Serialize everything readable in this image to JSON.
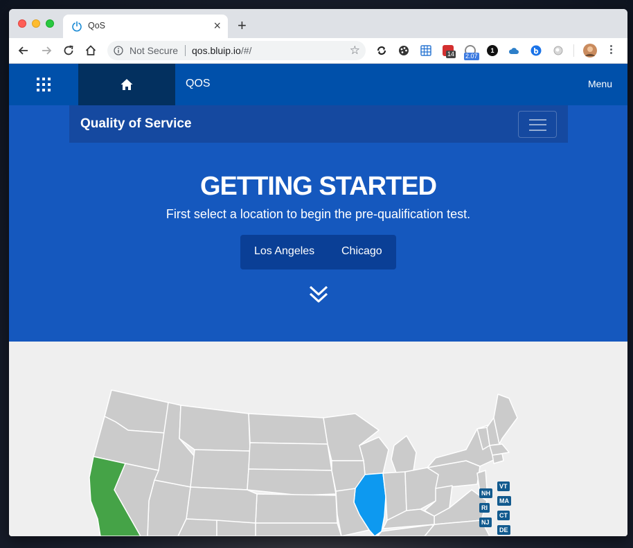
{
  "browser": {
    "tab_title": "QoS",
    "address_security": "Not Secure",
    "address_host": "qos.bluip.io",
    "address_path": "/#/",
    "ext_badges": [
      "14",
      "2.07"
    ],
    "ext_count_label": "1"
  },
  "topnav": {
    "brand": "QOS",
    "menu_label": "Menu"
  },
  "subnav": {
    "title": "Quality of Service"
  },
  "hero": {
    "title": "GETTING STARTED",
    "subtitle": "First select a location to begin the pre-qualification test.",
    "locations": [
      "Los Angeles",
      "Chicago"
    ]
  },
  "map": {
    "colors": {
      "land": "#cbcbcb",
      "border": "#ffffff",
      "california": "#45a347",
      "illinois": "#0d99f0",
      "badge": "#125a8e"
    },
    "highlighted": [
      "CA",
      "IL"
    ],
    "state_badges": [
      "NH",
      "RI",
      "NJ",
      "VT",
      "MA",
      "CT",
      "DE"
    ]
  }
}
